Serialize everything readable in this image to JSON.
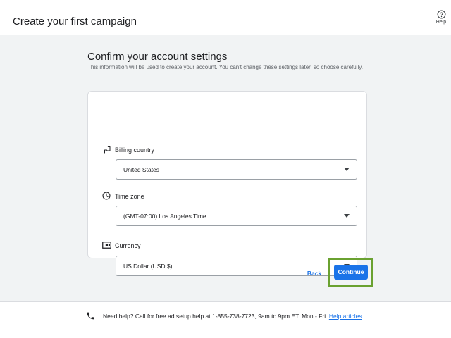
{
  "header": {
    "title": "Create your first campaign",
    "help_label": "Help"
  },
  "main": {
    "heading": "Confirm your account settings",
    "subtext": "This information will be used to create your account. You can't change these settings later, so choose carefully."
  },
  "fields": {
    "billing_country": {
      "label": "Billing country",
      "value": "United States",
      "icon": "flag-icon"
    },
    "time_zone": {
      "label": "Time zone",
      "value": "(GMT-07:00) Los Angeles Time",
      "icon": "clock-icon"
    },
    "currency": {
      "label": "Currency",
      "value": "US Dollar (USD $)",
      "icon": "money-icon"
    }
  },
  "actions": {
    "back_label": "Back",
    "continue_label": "Continue"
  },
  "footer": {
    "help_text": "Need help? Call for free ad setup help at 1-855-738-7723, 9am to 9pm ET, Mon - Fri.",
    "link_label": "Help articles"
  },
  "colors": {
    "accent": "#1a73e8",
    "highlight": "#6aa130",
    "background": "#f1f3f4"
  }
}
